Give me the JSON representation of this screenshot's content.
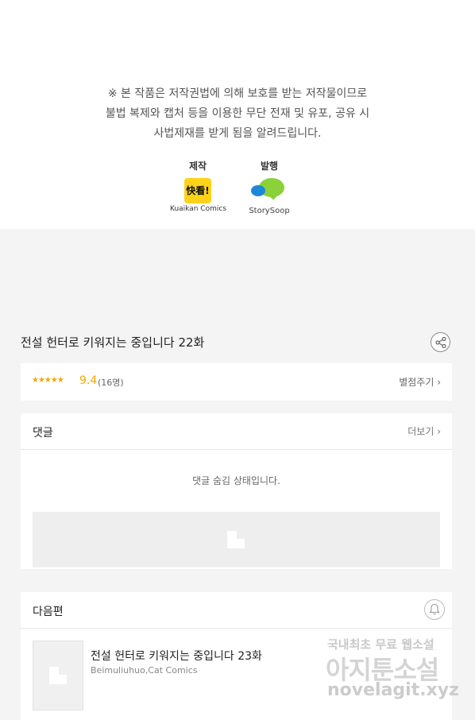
{
  "notice": {
    "lines": [
      "※ 본 작품은 저작권법에 의해 보호를 받는 저작물이므로",
      "불법 복제와 캡처 등을 이용한 무단 전재 및 유포, 공유 시",
      "사법제재를 받게 됨을 알려드립니다."
    ]
  },
  "credits": {
    "production_label": "제작",
    "production_logo_text": "快看!",
    "production_name": "Kuaikan Comics",
    "publisher_label": "발행",
    "publisher_name": "StorySoop"
  },
  "episode": {
    "title": "전설 헌터로 키워지는 중입니다 22화",
    "share_icon": "share-icon"
  },
  "rating": {
    "stars": "★★★★★",
    "score": "9.4",
    "count": "(16명)",
    "rate_label": "별점주기 ›",
    "star_color": "#f2a700"
  },
  "comments": {
    "title": "댓글",
    "more_label": "더보기 ›",
    "hidden_message": "댓글 숨김 상태입니다."
  },
  "next": {
    "title": "다음편",
    "episode_title": "전설 헌터로 키워지는 중입니다 23화",
    "authors": "Beimuliuhuo,Cat Comics",
    "bell_icon": "bell-icon"
  },
  "watermark": {
    "line1": "국내최초 무료 웹소설",
    "line2": "아지툰소설",
    "line3": "novelagit.xyz"
  }
}
